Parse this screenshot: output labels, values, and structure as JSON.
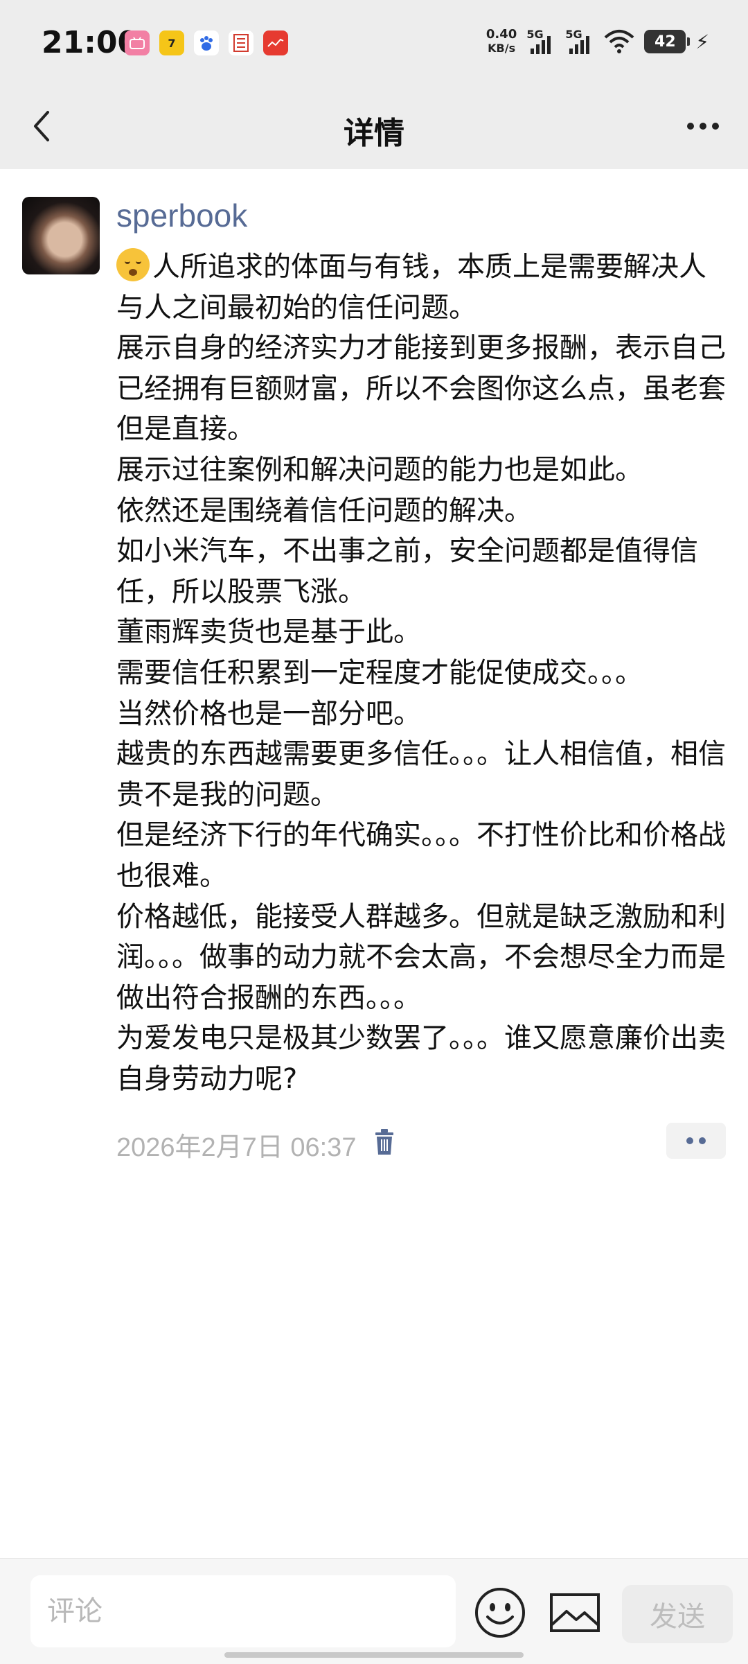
{
  "status_bar": {
    "time": "21:00",
    "net_speed_value": "0.40",
    "net_speed_unit": "KB/s",
    "signal1_label": "5G",
    "signal2_label": "5G",
    "battery": "42",
    "app_icons": [
      "bilibili-icon",
      "app-7-icon",
      "baidu-icon",
      "seal-icon",
      "stock-app-icon"
    ]
  },
  "header": {
    "title": "详情",
    "back_icon": "chevron-left-icon",
    "more_icon": "more-icon"
  },
  "post": {
    "username": "sperbook",
    "lines": [
      "人所追求的体面与有钱，本质上是需要解决人与人之间最初始的信任问题。",
      "展示自身的经济实力才能接到更多报酬，表示自己已经拥有巨额财富，所以不会图你这么点，虽老套但是直接。",
      "展示过往案例和解决问题的能力也是如此。",
      "依然还是围绕着信任问题的解决。",
      "如小米汽车，不出事之前，安全问题都是值得信任，所以股票飞涨。",
      "董雨辉卖货也是基于此。",
      "需要信任积累到一定程度才能促使成交。。。",
      "当然价格也是一部分吧。",
      "越贵的东西越需要更多信任。。。让人相信值，相信贵不是我的问题。",
      "但是经济下行的年代确实。。。不打性价比和价格战也很难。",
      "价格越低，能接受人群越多。但就是缺乏激励和利润。。。做事的动力就不会太高，不会想尽全力而是做出符合报酬的东西。。。",
      "为爱发电只是极其少数罢了。。。谁又愿意廉价出卖自身劳动力呢?"
    ],
    "timestamp": "2026年2月7日 06:37"
  },
  "bottom_bar": {
    "comment_placeholder": "评论",
    "send_label": "发送"
  },
  "colors": {
    "username": "#576b95",
    "header_bg": "#ededed",
    "timestamp": "#b2b2b2"
  }
}
